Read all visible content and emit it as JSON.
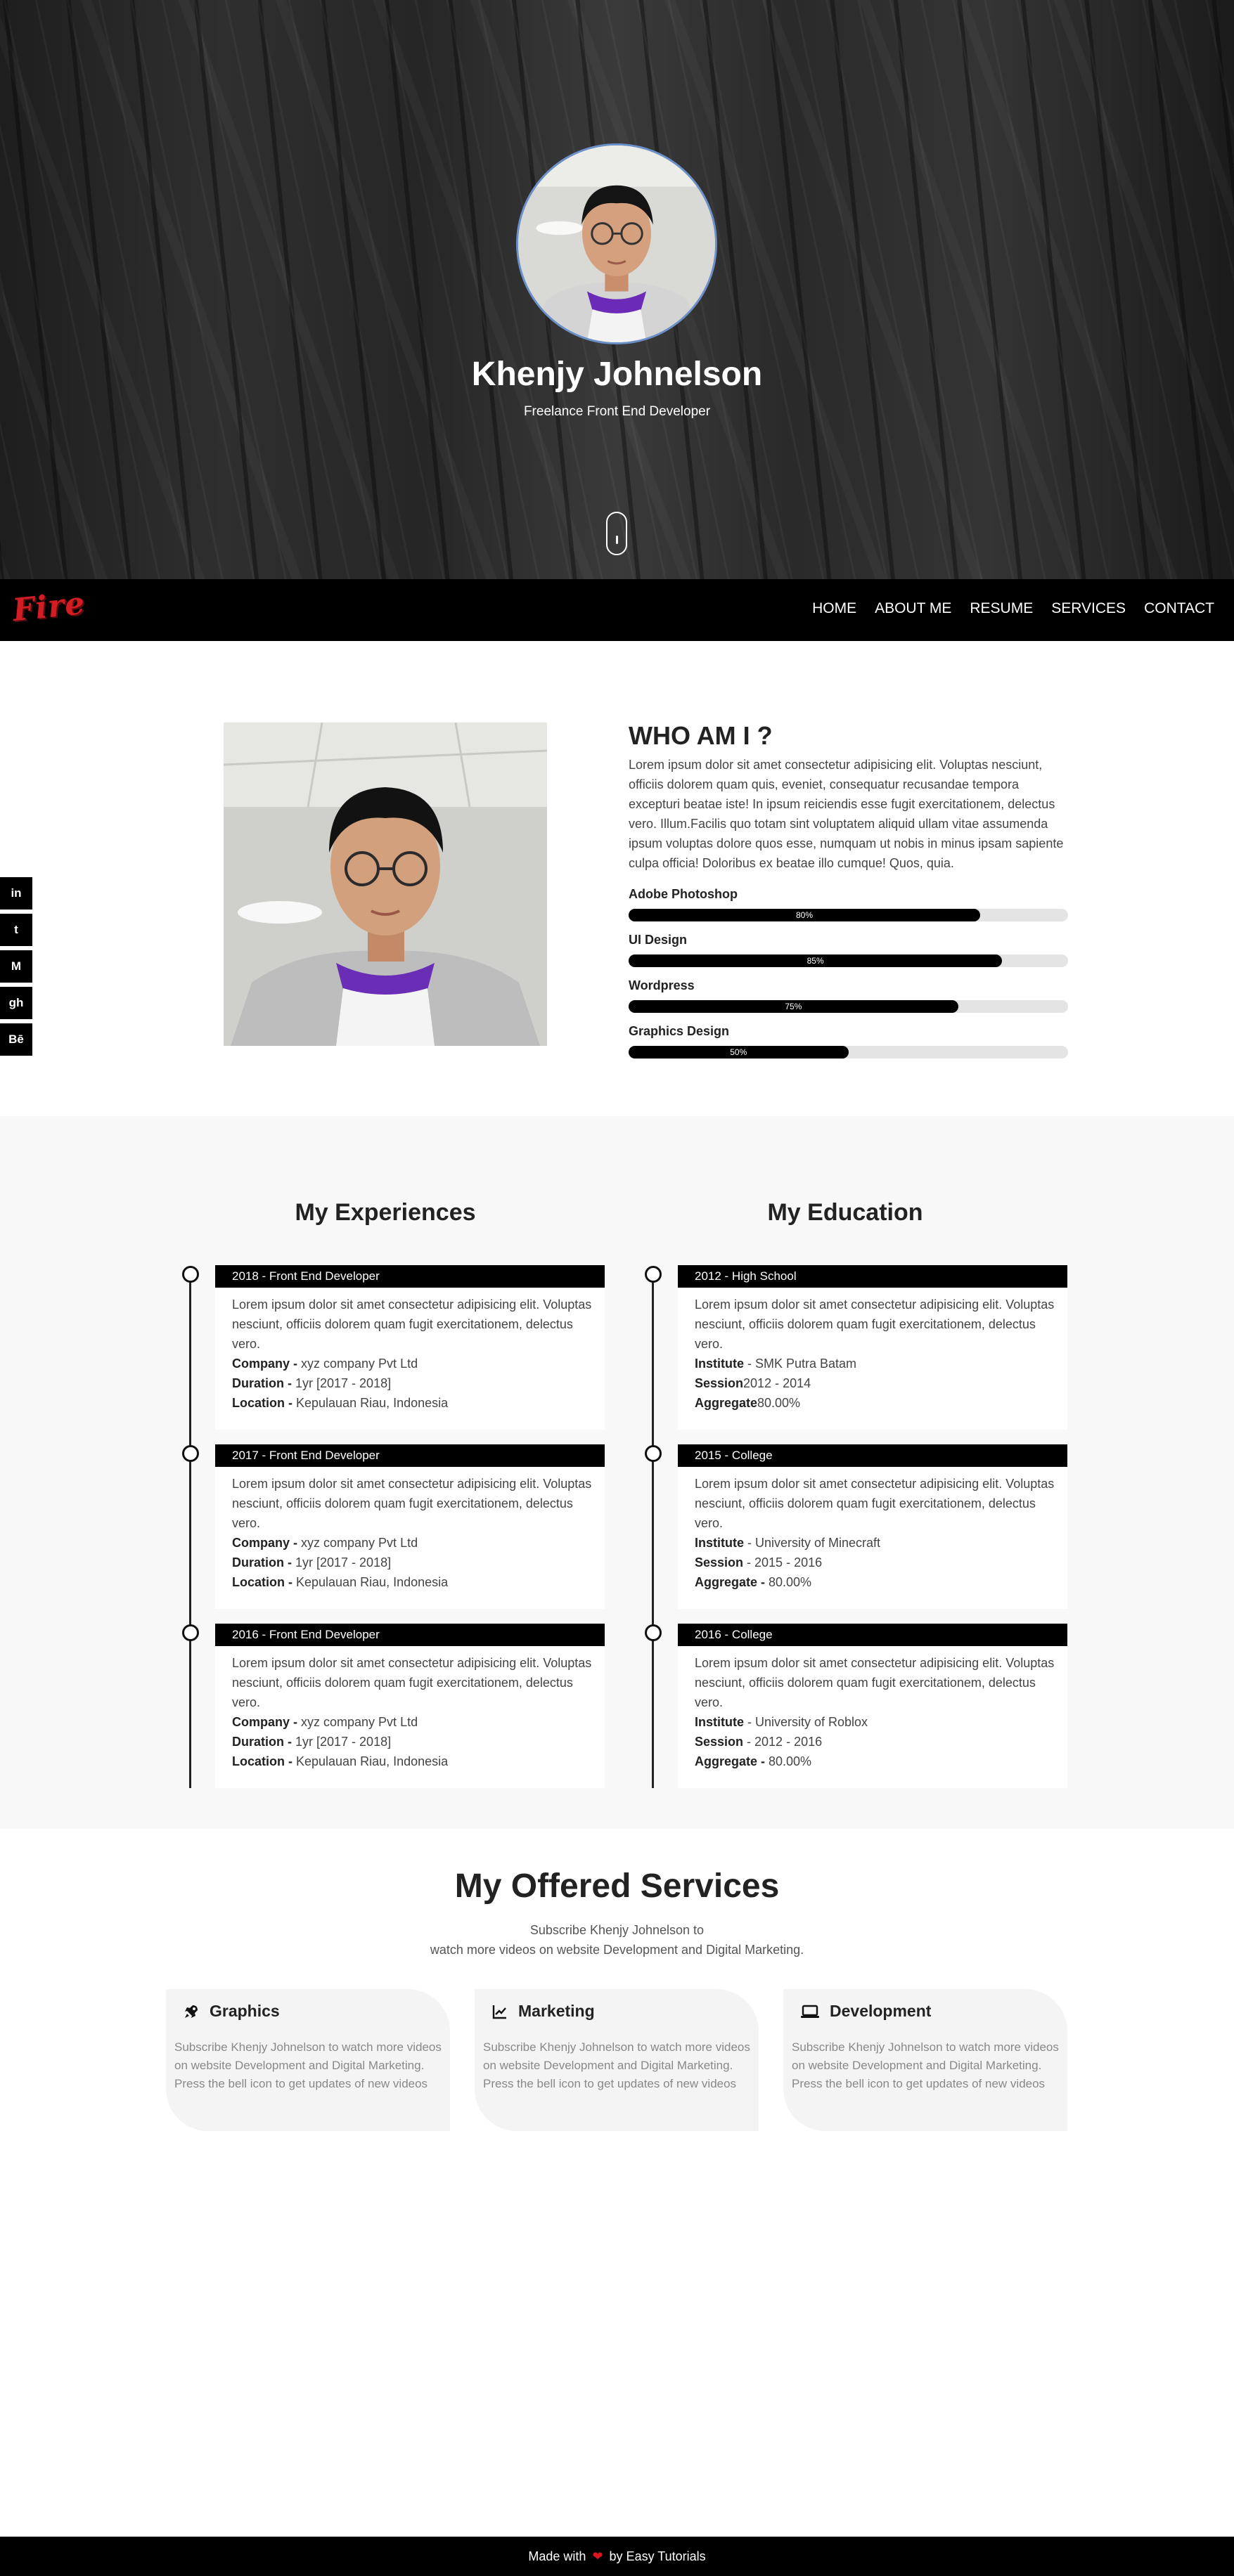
{
  "hero": {
    "name": "Khenjy Johnelson",
    "subtitle": "Freelance Front End Developer"
  },
  "nav": {
    "logo": "Fire",
    "items": [
      "HOME",
      "ABOUT ME",
      "RESUME",
      "SERVICES",
      "CONTACT"
    ]
  },
  "about": {
    "title": "WHO AM I ?",
    "text": "Lorem ipsum dolor sit amet consectetur adipisicing elit. Voluptas nesciunt, officiis dolorem quam quis, eveniet, consequatur recusandae tempora excepturi beatae iste! In ipsum reiciendis esse fugit exercitationem, delectus vero. Illum.Facilis quo totam sint voluptatem aliquid ullam vitae assumenda ipsum voluptas dolore quos esse, numquam ut nobis in minus ipsam sapiente culpa officia! Doloribus ex beatae illo cumque! Quos, quia.",
    "skills": [
      {
        "name": "Adobe Photoshop",
        "label": "80%",
        "value": 0.8
      },
      {
        "name": "UI Design",
        "label": "85%",
        "value": 0.85
      },
      {
        "name": "Wordpress",
        "label": "75%",
        "value": 0.75
      },
      {
        "name": "Graphics Design",
        "label": "50%",
        "value": 0.5
      }
    ]
  },
  "social": [
    {
      "icon": "linkedin-icon",
      "glyph": "in"
    },
    {
      "icon": "twitch-icon",
      "glyph": "t"
    },
    {
      "icon": "medium-icon",
      "glyph": "M"
    },
    {
      "icon": "github-icon",
      "glyph": "gh"
    },
    {
      "icon": "behance-icon",
      "glyph": "Bē"
    }
  ],
  "experience": {
    "title": "My Experiences",
    "items": [
      {
        "head": "2018 - Front End Developer",
        "text": "Lorem ipsum dolor sit amet consectetur adipisicing elit. Voluptas nesciunt, officiis dolorem quam fugit exercitationem, delectus vero.",
        "l1k": "Company -",
        "l1v": " xyz company Pvt Ltd",
        "l2k": "Duration -",
        "l2v": " 1yr [2017 - 2018]",
        "l3k": "Location -",
        "l3v": " Kepulauan Riau, Indonesia"
      },
      {
        "head": "2017 - Front End Developer",
        "text": "Lorem ipsum dolor sit amet consectetur adipisicing elit. Voluptas nesciunt, officiis dolorem quam fugit exercitationem, delectus vero.",
        "l1k": "Company -",
        "l1v": " xyz company Pvt Ltd",
        "l2k": "Duration -",
        "l2v": " 1yr [2017 - 2018]",
        "l3k": "Location -",
        "l3v": " Kepulauan Riau, Indonesia"
      },
      {
        "head": "2016 - Front End Developer",
        "text": "Lorem ipsum dolor sit amet consectetur adipisicing elit. Voluptas nesciunt, officiis dolorem quam fugit exercitationem, delectus vero.",
        "l1k": "Company -",
        "l1v": " xyz company Pvt Ltd",
        "l2k": "Duration -",
        "l2v": " 1yr [2017 - 2018]",
        "l3k": "Location -",
        "l3v": " Kepulauan Riau, Indonesia"
      }
    ]
  },
  "education": {
    "title": "My Education",
    "items": [
      {
        "head": "2012 - High School",
        "text": "Lorem ipsum dolor sit amet consectetur adipisicing elit. Voluptas nesciunt, officiis dolorem quam fugit exercitationem, delectus vero.",
        "l1k": "Institute",
        "l1v": " - SMK Putra Batam",
        "l2k": "Session",
        "l2v": "2012 - 2014",
        "l3k": "Aggregate",
        "l3v": "80.00%"
      },
      {
        "head": "2015 - College",
        "text": "Lorem ipsum dolor sit amet consectetur adipisicing elit. Voluptas nesciunt, officiis dolorem quam fugit exercitationem, delectus vero.",
        "l1k": "Institute",
        "l1v": " - University of Minecraft",
        "l2k": "Session",
        "l2v": " - 2015 - 2016",
        "l3k": "Aggregate -",
        "l3v": " 80.00%"
      },
      {
        "head": "2016 - College",
        "text": "Lorem ipsum dolor sit amet consectetur adipisicing elit. Voluptas nesciunt, officiis dolorem quam fugit exercitationem, delectus vero.",
        "l1k": "Institute",
        "l1v": " - University of Roblox",
        "l2k": "Session",
        "l2v": " - 2012 - 2016",
        "l3k": "Aggregate -",
        "l3v": " 80.00%"
      }
    ]
  },
  "services": {
    "title": "My Offered Services",
    "sub1": "Subscribe Khenjy Johnelson to",
    "sub2": "watch more videos on website Development and Digital Marketing.",
    "cards": [
      {
        "icon": "rocket-icon",
        "title": "Graphics",
        "text": "Subscribe Khenjy Johnelson to watch more videos on website Development and Digital Marketing. Press the bell icon to get updates of new videos"
      },
      {
        "icon": "chart-line-icon",
        "title": "Marketing",
        "text": "Subscribe Khenjy Johnelson to watch more videos on website Development and Digital Marketing. Press the bell icon to get updates of new videos"
      },
      {
        "icon": "laptop-icon",
        "title": "Development",
        "text": "Subscribe Khenjy Johnelson to watch more videos on website Development and Digital Marketing. Press the bell icon to get updates of new videos"
      }
    ]
  },
  "footer": {
    "before": "Made with",
    "after": "by Easy Tutorials"
  }
}
